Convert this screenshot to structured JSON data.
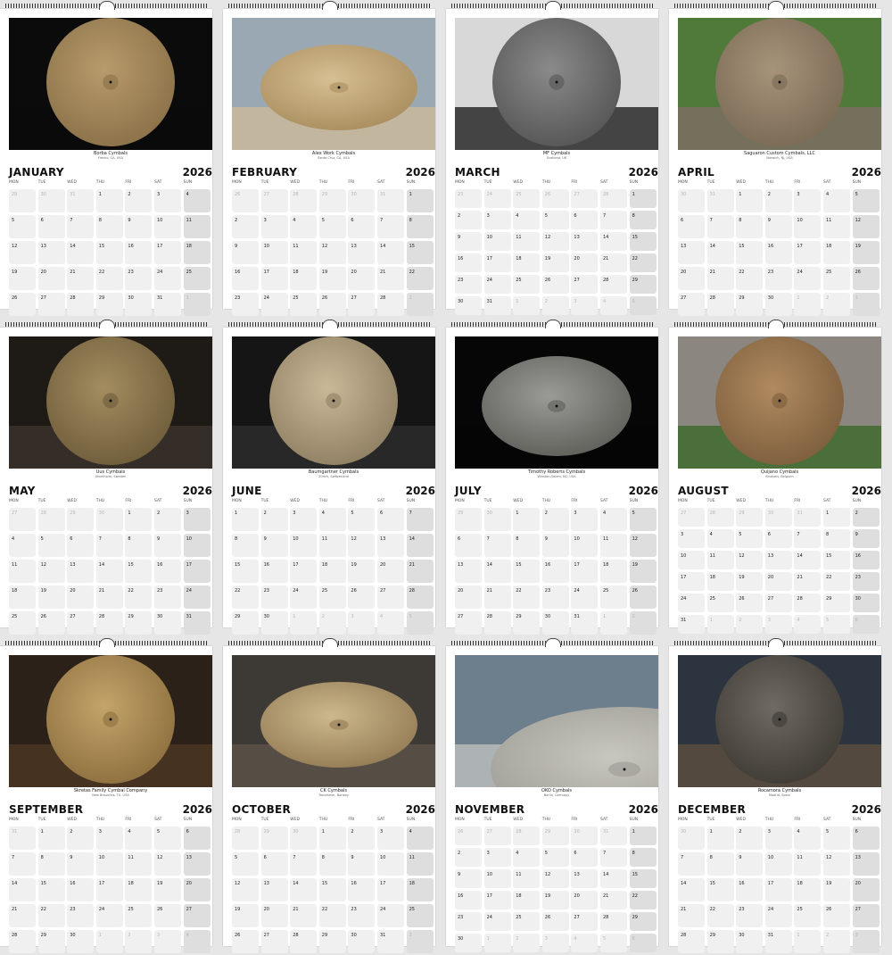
{
  "year": "2026",
  "weekdays": [
    "MON",
    "TUE",
    "WED",
    "THU",
    "FRI",
    "SAT",
    "SUN"
  ],
  "months": [
    {
      "name": "JANUARY",
      "caption_name": "Borba Cymbals",
      "caption_location": "Fresno, CA, USA",
      "weeks": [
        [
          29,
          30,
          31,
          1,
          2,
          3,
          4
        ],
        [
          5,
          6,
          7,
          8,
          9,
          10,
          11
        ],
        [
          12,
          13,
          14,
          15,
          16,
          17,
          18
        ],
        [
          19,
          20,
          21,
          22,
          23,
          24,
          25
        ],
        [
          26,
          27,
          28,
          29,
          30,
          31,
          1
        ]
      ],
      "photo": {
        "bg": "#0b0b0b",
        "ground": "#0b0b0b",
        "cymbal": "#b89b6c",
        "edge": "#8a7048",
        "type": "circle"
      }
    },
    {
      "name": "FEBRUARY",
      "caption_name": "Alex Work Cymbals",
      "caption_location": "Santa Cruz, CA, USA",
      "weeks": [
        [
          26,
          27,
          28,
          29,
          30,
          31,
          1
        ],
        [
          2,
          3,
          4,
          5,
          6,
          7,
          8
        ],
        [
          9,
          10,
          11,
          12,
          13,
          14,
          15
        ],
        [
          16,
          17,
          18,
          19,
          20,
          21,
          22
        ],
        [
          23,
          24,
          25,
          26,
          27,
          28,
          1
        ]
      ],
      "photo": {
        "bg": "#9aa8b3",
        "ground": "#c9b99b",
        "cymbal": "#d6bf93",
        "edge": "#a98d5e",
        "type": "tilted"
      }
    },
    {
      "name": "MARCH",
      "caption_name": "MF Cymbals",
      "caption_location": "Scotland, UK",
      "weeks": [
        [
          23,
          24,
          25,
          26,
          27,
          28,
          1
        ],
        [
          2,
          3,
          4,
          5,
          6,
          7,
          8
        ],
        [
          9,
          10,
          11,
          12,
          13,
          14,
          15
        ],
        [
          16,
          17,
          18,
          19,
          20,
          21,
          22
        ],
        [
          23,
          24,
          25,
          26,
          27,
          28,
          29
        ],
        [
          30,
          31,
          1,
          2,
          3,
          4,
          5
        ]
      ],
      "photo": {
        "bg": "#d8d8d8",
        "ground": "#2a2a2a",
        "cymbal": "#8a8a8a",
        "edge": "#555555",
        "type": "circle"
      }
    },
    {
      "name": "APRIL",
      "caption_name": "Saguaron Custom Cymbals, LLC",
      "caption_location": "Norwich, NJ, USA",
      "weeks": [
        [
          30,
          31,
          1,
          2,
          3,
          4,
          5
        ],
        [
          6,
          7,
          8,
          9,
          10,
          11,
          12
        ],
        [
          13,
          14,
          15,
          16,
          17,
          18,
          19
        ],
        [
          20,
          21,
          22,
          23,
          24,
          25,
          26
        ],
        [
          27,
          28,
          29,
          30,
          1,
          2,
          3
        ]
      ],
      "photo": {
        "bg": "#4f7a3a",
        "ground": "#7b6f62",
        "cymbal": "#a6937a",
        "edge": "#7a6a54",
        "type": "circle"
      }
    },
    {
      "name": "MAY",
      "caption_name": "Uus Cymbals",
      "caption_location": "Stockholm, Sweden",
      "weeks": [
        [
          27,
          28,
          29,
          30,
          1,
          2,
          3
        ],
        [
          4,
          5,
          6,
          7,
          8,
          9,
          10
        ],
        [
          11,
          12,
          13,
          14,
          15,
          16,
          17
        ],
        [
          18,
          19,
          20,
          21,
          22,
          23,
          24
        ],
        [
          25,
          26,
          27,
          28,
          29,
          30,
          31
        ]
      ],
      "photo": {
        "bg": "#1e1a16",
        "ground": "#3a332b",
        "cymbal": "#a38d60",
        "edge": "#6e5c3a",
        "type": "circle"
      }
    },
    {
      "name": "JUNE",
      "caption_name": "Baumgartner Cymbals",
      "caption_location": "Zürich, Switzerland",
      "weeks": [
        [
          1,
          2,
          3,
          4,
          5,
          6,
          7
        ],
        [
          8,
          9,
          10,
          11,
          12,
          13,
          14
        ],
        [
          15,
          16,
          17,
          18,
          19,
          20,
          21
        ],
        [
          22,
          23,
          24,
          25,
          26,
          27,
          28
        ],
        [
          29,
          30,
          1,
          2,
          3,
          4,
          5
        ]
      ],
      "photo": {
        "bg": "#151515",
        "ground": "#2b2b2b",
        "cymbal": "#c9b898",
        "edge": "#8f7f62",
        "type": "circle"
      }
    },
    {
      "name": "JULY",
      "caption_name": "Timothy Roberts Cymbals",
      "caption_location": "Winston-Salem, NC, USA",
      "weeks": [
        [
          29,
          30,
          1,
          2,
          3,
          4,
          5
        ],
        [
          6,
          7,
          8,
          9,
          10,
          11,
          12
        ],
        [
          13,
          14,
          15,
          16,
          17,
          18,
          19
        ],
        [
          20,
          21,
          22,
          23,
          24,
          25,
          26
        ],
        [
          27,
          28,
          29,
          30,
          31,
          1,
          2
        ]
      ],
      "photo": {
        "bg": "#060606",
        "ground": "#060606",
        "cymbal": "#9a9a96",
        "edge": "#5f5f5a",
        "type": "ellipse"
      }
    },
    {
      "name": "AUGUST",
      "caption_name": "Quijano Cymbals",
      "caption_location": "Brussels, Belgium",
      "weeks": [
        [
          27,
          28,
          29,
          30,
          31,
          1,
          2
        ],
        [
          3,
          4,
          5,
          6,
          7,
          8,
          9
        ],
        [
          10,
          11,
          12,
          13,
          14,
          15,
          16
        ],
        [
          17,
          18,
          19,
          20,
          21,
          22,
          23
        ],
        [
          24,
          25,
          26,
          27,
          28,
          29,
          30
        ],
        [
          31,
          1,
          2,
          3,
          4,
          5,
          6
        ]
      ],
      "photo": {
        "bg": "#8c8680",
        "ground": "#3f6b2e",
        "cymbal": "#b08a60",
        "edge": "#7c5e3c",
        "type": "circle"
      }
    },
    {
      "name": "SEPTEMBER",
      "caption_name": "Skretas Family Cymbal Company",
      "caption_location": "New Braunfels, TX, USA",
      "weeks": [
        [
          31,
          1,
          2,
          3,
          4,
          5,
          6
        ],
        [
          7,
          8,
          9,
          10,
          11,
          12,
          13
        ],
        [
          14,
          15,
          16,
          17,
          18,
          19,
          20
        ],
        [
          21,
          22,
          23,
          24,
          25,
          26,
          27
        ],
        [
          28,
          29,
          30,
          1,
          2,
          3,
          4
        ]
      ],
      "photo": {
        "bg": "#2b2119",
        "ground": "#4a3523",
        "cymbal": "#c4a46a",
        "edge": "#8c6f3e",
        "type": "circle"
      }
    },
    {
      "name": "OCTOBER",
      "caption_name": "CK Cymbals",
      "caption_location": "Trondheim, Norway",
      "weeks": [
        [
          28,
          29,
          30,
          1,
          2,
          3,
          4
        ],
        [
          5,
          6,
          7,
          8,
          9,
          10,
          11
        ],
        [
          12,
          13,
          14,
          15,
          16,
          17,
          18
        ],
        [
          19,
          20,
          21,
          22,
          23,
          24,
          25
        ],
        [
          26,
          27,
          28,
          29,
          30,
          31,
          1
        ]
      ],
      "photo": {
        "bg": "#3d3a36",
        "ground": "#5a5148",
        "cymbal": "#cdb78c",
        "edge": "#937c55",
        "type": "tilted"
      }
    },
    {
      "name": "NOVEMBER",
      "caption_name": "OKO Cymbals",
      "caption_location": "Berlin, Germany",
      "weeks": [
        [
          26,
          27,
          28,
          29,
          30,
          31,
          1
        ],
        [
          2,
          3,
          4,
          5,
          6,
          7,
          8
        ],
        [
          9,
          10,
          11,
          12,
          13,
          14,
          15
        ],
        [
          16,
          17,
          18,
          19,
          20,
          21,
          22
        ],
        [
          23,
          24,
          25,
          26,
          27,
          28,
          29
        ],
        [
          30,
          1,
          2,
          3,
          4,
          5,
          6
        ]
      ],
      "photo": {
        "bg": "#6d7f8c",
        "ground": "#b9bcbc",
        "cymbal": "#c7c6bf",
        "edge": "#9b9a92",
        "type": "edge"
      }
    },
    {
      "name": "DECEMBER",
      "caption_name": "Rocamora Cymbals",
      "caption_location": "Madrid, Spain",
      "weeks": [
        [
          30,
          1,
          2,
          3,
          4,
          5,
          6
        ],
        [
          7,
          8,
          9,
          10,
          11,
          12,
          13
        ],
        [
          14,
          15,
          16,
          17,
          18,
          19,
          20
        ],
        [
          21,
          22,
          23,
          24,
          25,
          26,
          27
        ],
        [
          28,
          29,
          30,
          31,
          1,
          2,
          3
        ]
      ],
      "photo": {
        "bg": "#2c3440",
        "ground": "#5b4d3f",
        "cymbal": "#6f6a62",
        "edge": "#3e3a34",
        "type": "circle"
      }
    }
  ]
}
